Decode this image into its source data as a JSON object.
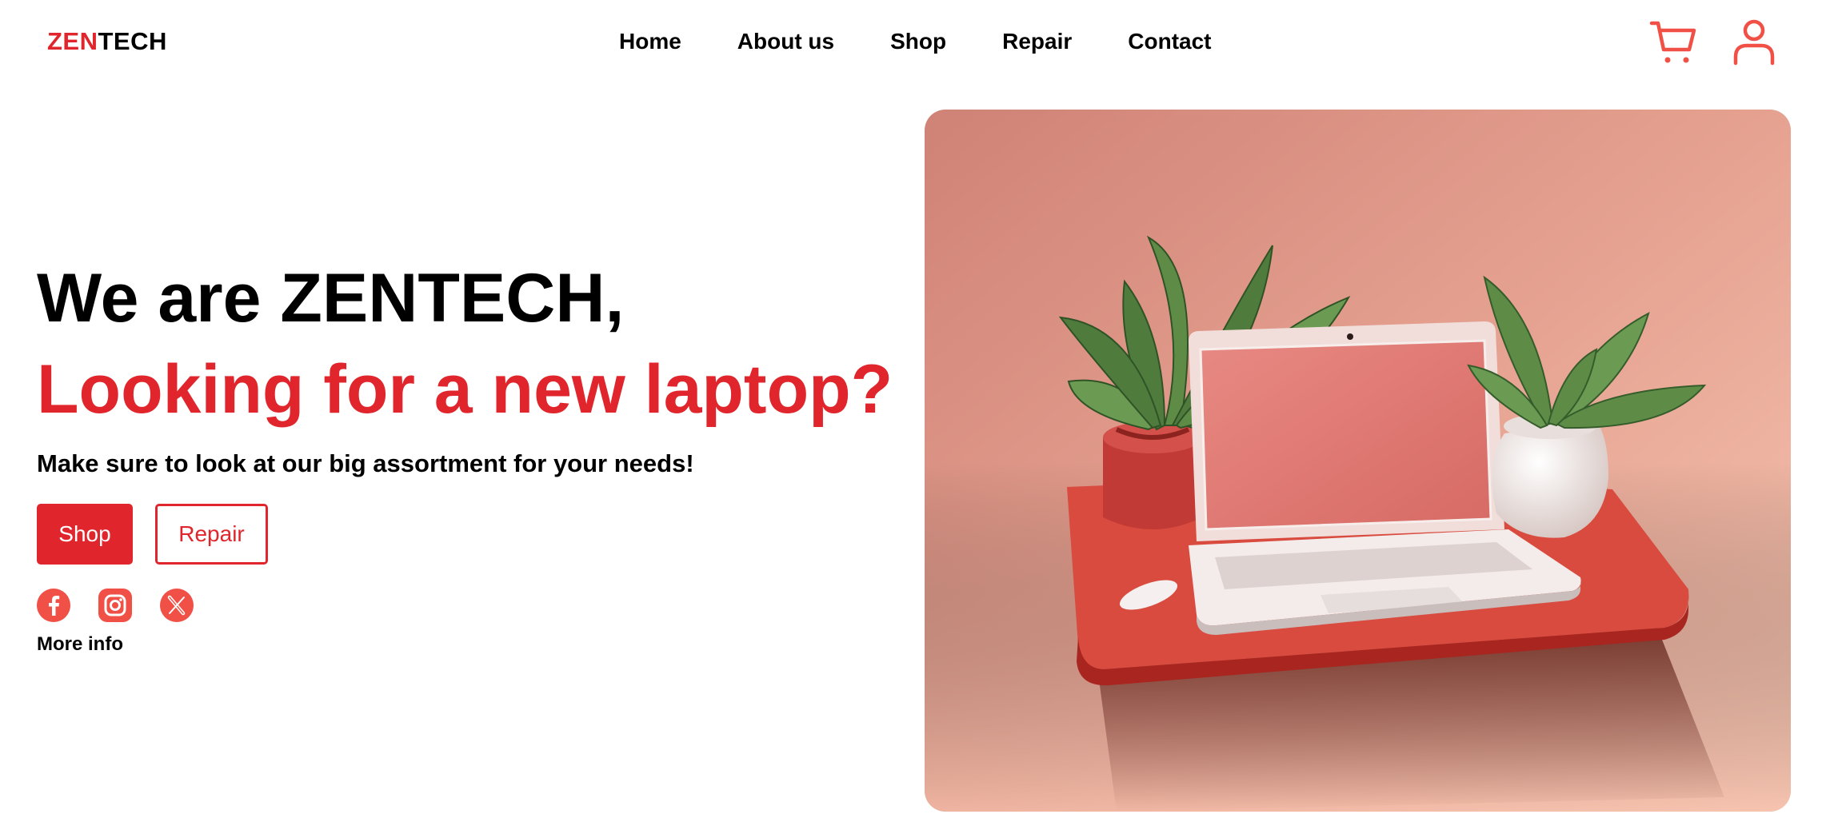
{
  "brand": {
    "part1": "ZEN",
    "part2": "TECH",
    "accent_color": "#e0262c"
  },
  "nav": {
    "items": [
      {
        "label": "Home"
      },
      {
        "label": "About us"
      },
      {
        "label": "Shop"
      },
      {
        "label": "Repair"
      },
      {
        "label": "Contact"
      }
    ]
  },
  "header_icons": [
    "cart-icon",
    "user-icon"
  ],
  "hero": {
    "title": "We are ZENTECH,",
    "headline": "Looking for a new laptop?",
    "subtitle": "Make sure to look at our big assortment for your needs!",
    "buttons": {
      "shop": "Shop",
      "repair": "Repair"
    },
    "social_icons": [
      "facebook-icon",
      "instagram-icon",
      "x-twitter-icon"
    ],
    "more_info": "More info"
  }
}
